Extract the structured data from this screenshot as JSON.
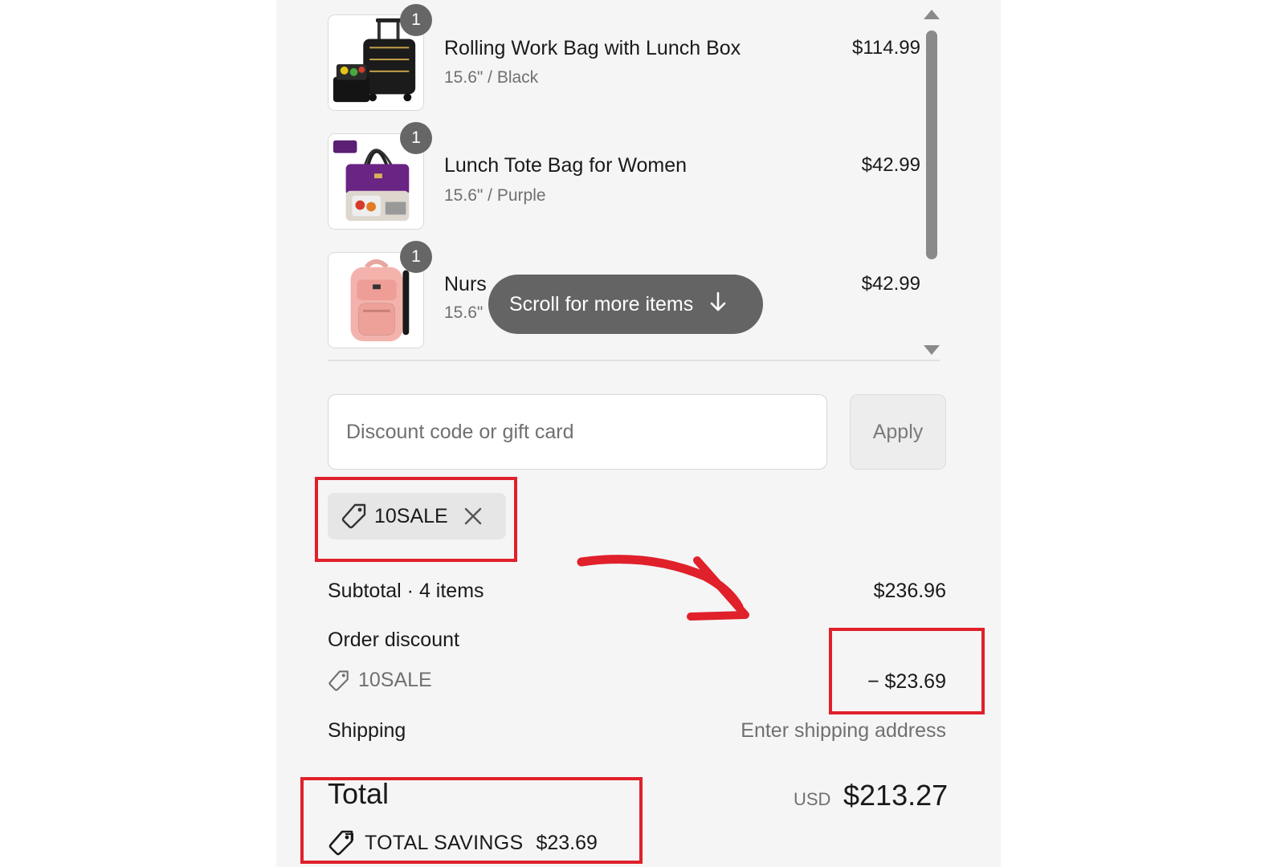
{
  "cart": {
    "items": [
      {
        "name": "Rolling Work Bag with Lunch Box",
        "variant": "15.6\" / Black",
        "price": "$114.99",
        "quantity": "1"
      },
      {
        "name": "Lunch Tote Bag for Women",
        "variant": "15.6\" / Purple",
        "price": "$42.99",
        "quantity": "1"
      },
      {
        "name": "Nurs",
        "variant": "15.6\"",
        "price": "$42.99",
        "quantity": "1"
      }
    ],
    "scroll_hint": "Scroll for more items"
  },
  "discount": {
    "placeholder": "Discount code or gift card",
    "apply_label": "Apply",
    "applied_code": "10SALE"
  },
  "summary": {
    "subtotal_label": "Subtotal · 4 items",
    "subtotal_value": "$236.96",
    "order_discount_label": "Order discount",
    "order_discount_code": "10SALE",
    "order_discount_value": "− $23.69",
    "shipping_label": "Shipping",
    "shipping_value": "Enter shipping address",
    "total_label": "Total",
    "total_currency": "USD",
    "total_value": "$213.27",
    "savings_label": "TOTAL SAVINGS",
    "savings_value": "$23.69"
  },
  "colors": {
    "highlight": "#e0202a",
    "panel_bg": "#f5f5f5",
    "pill_bg": "#646464"
  }
}
